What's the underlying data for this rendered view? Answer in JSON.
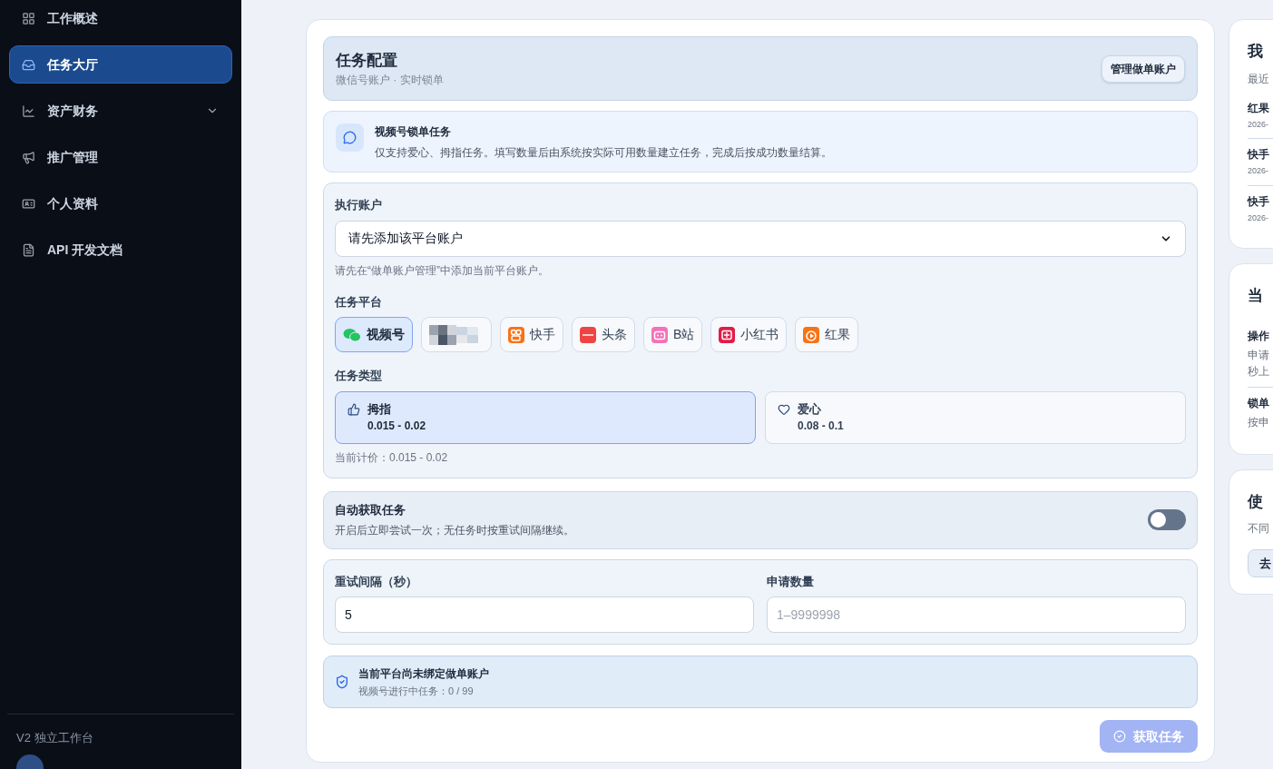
{
  "sidebar": {
    "items": [
      {
        "label": "工作概述",
        "selected": false,
        "expandable": false
      },
      {
        "label": "任务大厅",
        "selected": true,
        "expandable": false
      },
      {
        "label": "资产财务",
        "selected": false,
        "expandable": true
      },
      {
        "label": "推广管理",
        "selected": false,
        "expandable": false
      },
      {
        "label": "个人资料",
        "selected": false,
        "expandable": false
      },
      {
        "label": "API 开发文档",
        "selected": false,
        "expandable": false
      }
    ],
    "footer": "V2 独立工作台"
  },
  "config": {
    "title": "任务配置",
    "subtitle": "微信号账户 · 实时锁单",
    "manage_button": "管理做单账户",
    "notice": {
      "title": "视频号锁单任务",
      "text": "仅支持爱心、拇指任务。填写数量后由系统按实际可用数量建立任务，完成后按成功数量结算。"
    },
    "account": {
      "label": "执行账户",
      "value": "请先添加该平台账户",
      "hint": "请先在“做单账户管理”中添加当前平台账户。"
    },
    "platform_label": "任务平台",
    "platforms": [
      {
        "kind": "wechat",
        "label": "视频号",
        "selected": true
      },
      {
        "kind": "picture",
        "selected": false
      },
      {
        "kind": "kuaishou",
        "label": "快手",
        "selected": false
      },
      {
        "kind": "toutiao",
        "label": "头条",
        "selected": false
      },
      {
        "kind": "bilibili",
        "label": "B站",
        "selected": false
      },
      {
        "kind": "xhs",
        "label": "小红书",
        "selected": false
      },
      {
        "kind": "hongguo",
        "label": "红果",
        "selected": false
      }
    ],
    "type_label": "任务类型",
    "types": [
      {
        "kind": "thumb",
        "label": "拇指",
        "price": "0.015 - 0.02",
        "selected": true
      },
      {
        "kind": "heart",
        "label": "爱心",
        "price": "0.08 - 0.1",
        "selected": false
      }
    ],
    "current_price": "当前计价：0.015 - 0.02",
    "auto": {
      "title": "自动获取任务",
      "text": "开启后立即尝试一次；无任务时按重试间隔继续。",
      "on": false
    },
    "retry": {
      "label": "重试间隔（秒）",
      "value": "5"
    },
    "quantity": {
      "label": "申请数量",
      "placeholder": "1–9999998"
    },
    "status": {
      "title": "当前平台尚未绑定做单账户",
      "text": "视频号进行中任务：0 / 99"
    },
    "submit": {
      "label": "获取任务",
      "disabled": true
    }
  },
  "right": {
    "cards": [
      {
        "title": "我",
        "subtitle": "最近",
        "rows": [
          {
            "title": "红果",
            "text": "2026-"
          },
          {
            "title": "快手",
            "text": "2026-"
          },
          {
            "title": "快手",
            "text": "2026-"
          }
        ]
      },
      {
        "title": "当",
        "rows": [
          {
            "title": "操作",
            "text": "申请",
            "text2": "秒上"
          },
          {
            "title": "锁单",
            "text": "按申"
          }
        ]
      },
      {
        "title": "使",
        "subtitle": "不同",
        "button": "去"
      }
    ]
  }
}
